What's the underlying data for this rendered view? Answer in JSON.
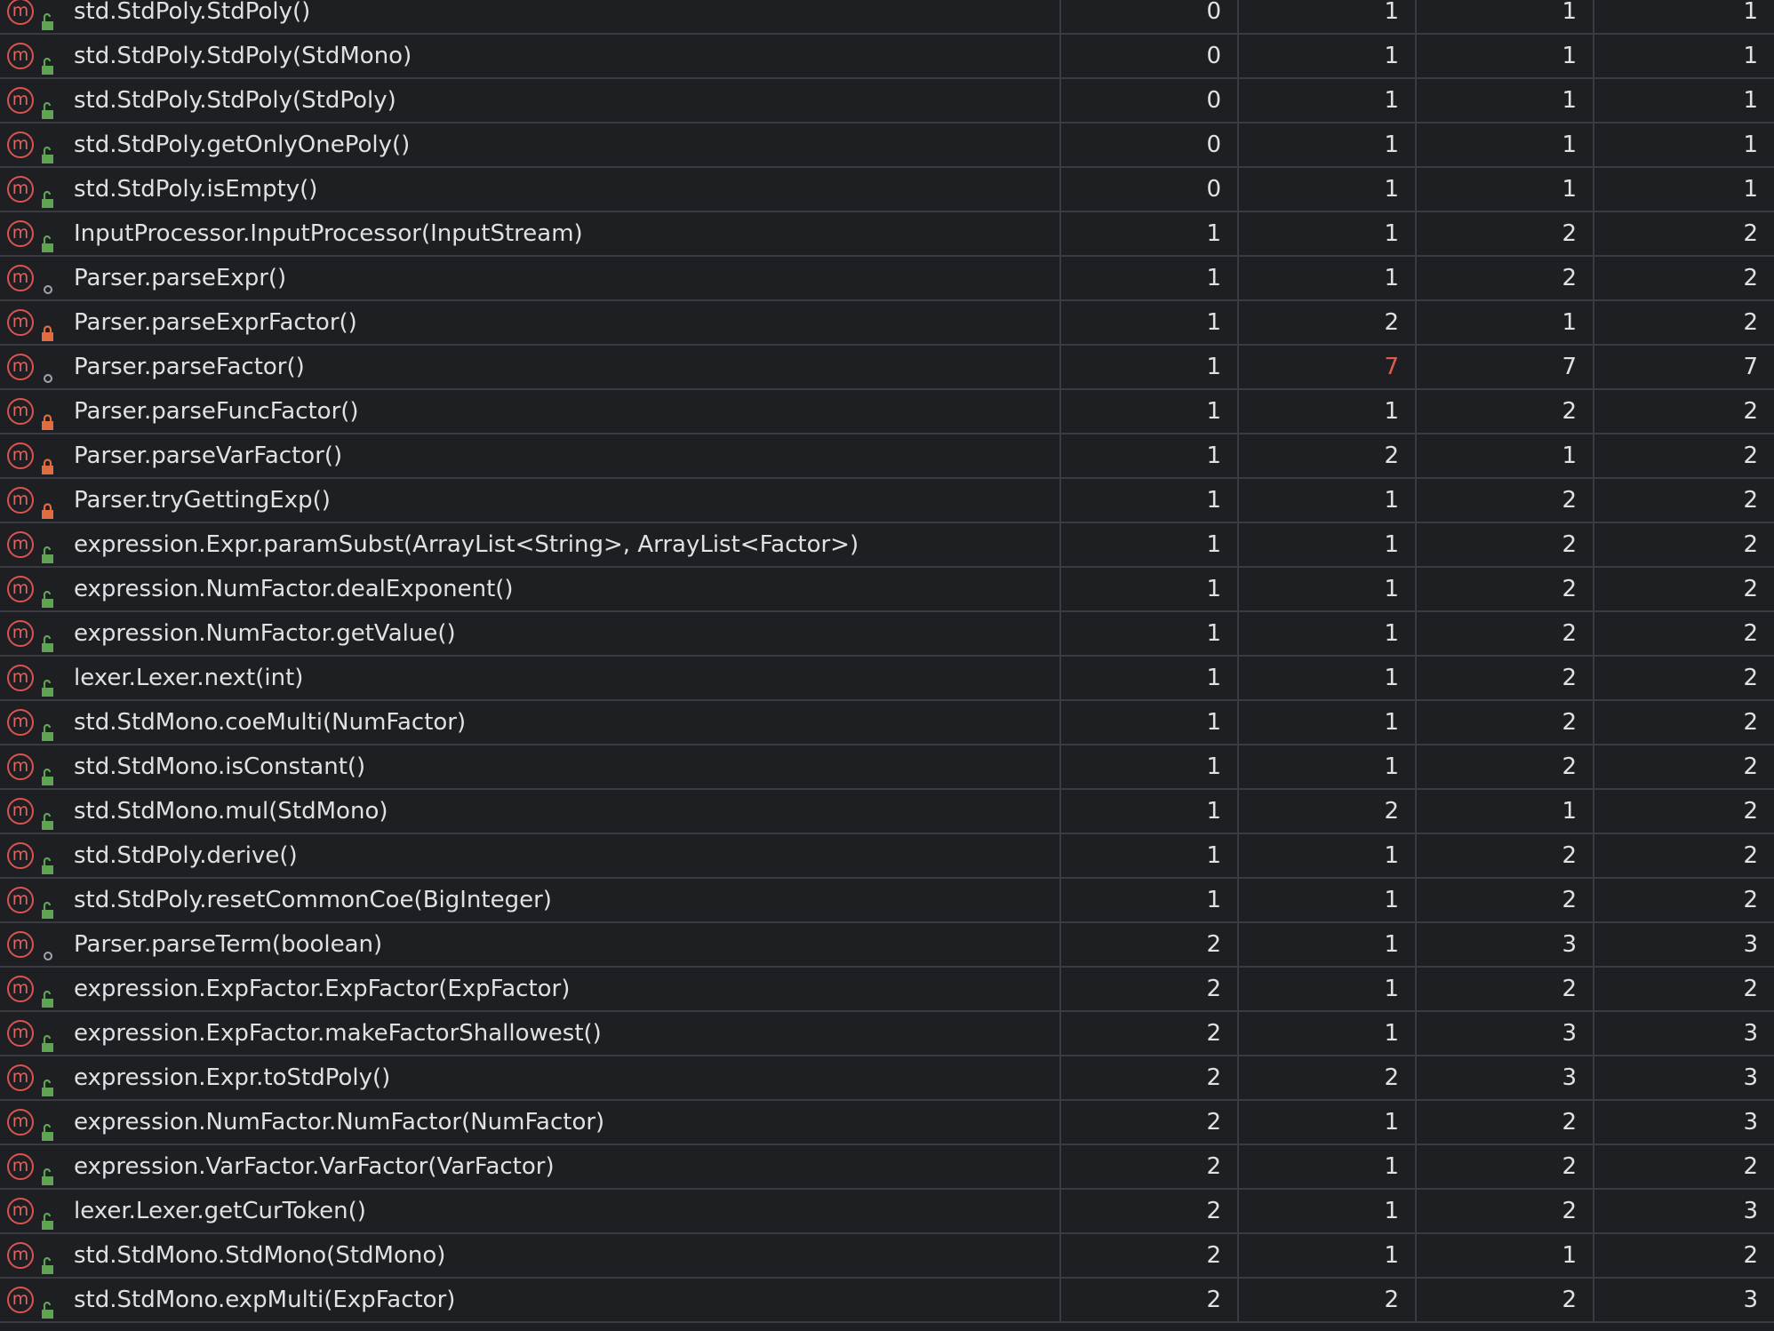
{
  "colors": {
    "background": "#1e1f22",
    "grid": "#393b40",
    "text": "#dfe1e5",
    "method_icon": "#d9534f",
    "public_icon": "#5fa453",
    "private_icon": "#e06c40",
    "package_icon": "#a0a4ab",
    "highlight_value": "#e05a4f"
  },
  "rows": [
    {
      "name": "std.StdPoly.StdPoly()",
      "access": "public",
      "v": [
        "0",
        "1",
        "1",
        "1"
      ]
    },
    {
      "name": "std.StdPoly.StdPoly(StdMono)",
      "access": "public",
      "v": [
        "0",
        "1",
        "1",
        "1"
      ]
    },
    {
      "name": "std.StdPoly.StdPoly(StdPoly)",
      "access": "public",
      "v": [
        "0",
        "1",
        "1",
        "1"
      ]
    },
    {
      "name": "std.StdPoly.getOnlyOnePoly()",
      "access": "public",
      "v": [
        "0",
        "1",
        "1",
        "1"
      ]
    },
    {
      "name": "std.StdPoly.isEmpty()",
      "access": "public",
      "v": [
        "0",
        "1",
        "1",
        "1"
      ]
    },
    {
      "name": "InputProcessor.InputProcessor(InputStream)",
      "access": "public",
      "v": [
        "1",
        "1",
        "2",
        "2"
      ]
    },
    {
      "name": "Parser.parseExpr()",
      "access": "package",
      "v": [
        "1",
        "1",
        "2",
        "2"
      ]
    },
    {
      "name": "Parser.parseExprFactor()",
      "access": "private",
      "v": [
        "1",
        "2",
        "1",
        "2"
      ]
    },
    {
      "name": "Parser.parseFactor()",
      "access": "package",
      "v": [
        "1",
        "7",
        "7",
        "7"
      ],
      "highlight": [
        1
      ]
    },
    {
      "name": "Parser.parseFuncFactor()",
      "access": "private",
      "v": [
        "1",
        "1",
        "2",
        "2"
      ]
    },
    {
      "name": "Parser.parseVarFactor()",
      "access": "private",
      "v": [
        "1",
        "2",
        "1",
        "2"
      ]
    },
    {
      "name": "Parser.tryGettingExp()",
      "access": "private",
      "v": [
        "1",
        "1",
        "2",
        "2"
      ]
    },
    {
      "name": "expression.Expr.paramSubst(ArrayList<String>, ArrayList<Factor>)",
      "access": "public",
      "v": [
        "1",
        "1",
        "2",
        "2"
      ]
    },
    {
      "name": "expression.NumFactor.dealExponent()",
      "access": "public",
      "v": [
        "1",
        "1",
        "2",
        "2"
      ]
    },
    {
      "name": "expression.NumFactor.getValue()",
      "access": "public",
      "v": [
        "1",
        "1",
        "2",
        "2"
      ]
    },
    {
      "name": "lexer.Lexer.next(int)",
      "access": "public",
      "v": [
        "1",
        "1",
        "2",
        "2"
      ]
    },
    {
      "name": "std.StdMono.coeMulti(NumFactor)",
      "access": "public",
      "v": [
        "1",
        "1",
        "2",
        "2"
      ]
    },
    {
      "name": "std.StdMono.isConstant()",
      "access": "public",
      "v": [
        "1",
        "1",
        "2",
        "2"
      ]
    },
    {
      "name": "std.StdMono.mul(StdMono)",
      "access": "public",
      "v": [
        "1",
        "2",
        "1",
        "2"
      ]
    },
    {
      "name": "std.StdPoly.derive()",
      "access": "public",
      "v": [
        "1",
        "1",
        "2",
        "2"
      ]
    },
    {
      "name": "std.StdPoly.resetCommonCoe(BigInteger)",
      "access": "public",
      "v": [
        "1",
        "1",
        "2",
        "2"
      ]
    },
    {
      "name": "Parser.parseTerm(boolean)",
      "access": "package",
      "v": [
        "2",
        "1",
        "3",
        "3"
      ]
    },
    {
      "name": "expression.ExpFactor.ExpFactor(ExpFactor)",
      "access": "public",
      "v": [
        "2",
        "1",
        "2",
        "2"
      ]
    },
    {
      "name": "expression.ExpFactor.makeFactorShallowest()",
      "access": "public",
      "v": [
        "2",
        "1",
        "3",
        "3"
      ]
    },
    {
      "name": "expression.Expr.toStdPoly()",
      "access": "public",
      "v": [
        "2",
        "2",
        "3",
        "3"
      ]
    },
    {
      "name": "expression.NumFactor.NumFactor(NumFactor)",
      "access": "public",
      "v": [
        "2",
        "1",
        "2",
        "3"
      ]
    },
    {
      "name": "expression.VarFactor.VarFactor(VarFactor)",
      "access": "public",
      "v": [
        "2",
        "1",
        "2",
        "2"
      ]
    },
    {
      "name": "lexer.Lexer.getCurToken()",
      "access": "public",
      "v": [
        "2",
        "1",
        "2",
        "3"
      ]
    },
    {
      "name": "std.StdMono.StdMono(StdMono)",
      "access": "public",
      "v": [
        "2",
        "1",
        "1",
        "2"
      ]
    },
    {
      "name": "std.StdMono.expMulti(ExpFactor)",
      "access": "public",
      "v": [
        "2",
        "2",
        "2",
        "3"
      ]
    }
  ],
  "method_icon_letter": "m"
}
